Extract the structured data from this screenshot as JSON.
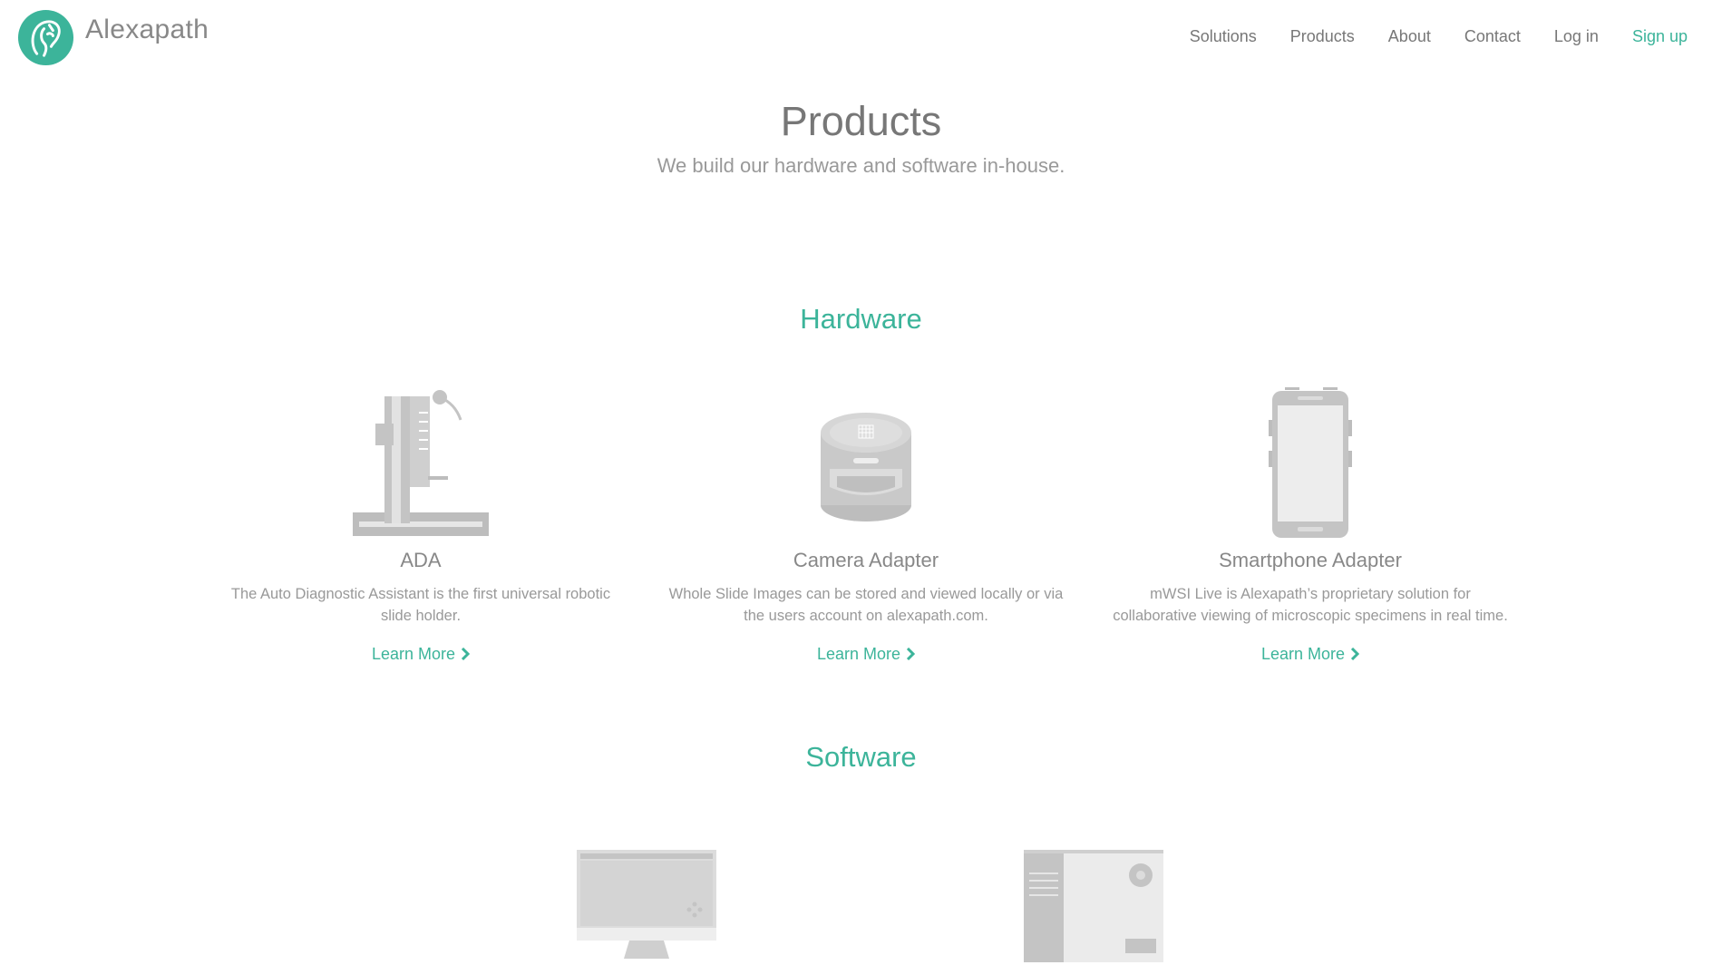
{
  "header": {
    "brand": "Alexapath",
    "nav": {
      "solutions": "Solutions",
      "products": "Products",
      "about": "About",
      "contact": "Contact",
      "login": "Log in",
      "signup": "Sign up"
    }
  },
  "page": {
    "title": "Products",
    "subtitle": "We build our hardware and software in-house."
  },
  "hardware": {
    "title": "Hardware",
    "items": [
      {
        "name": "ADA",
        "description": "The Auto Diagnostic Assistant is the first universal robotic slide holder.",
        "link": "Learn More",
        "icon": "robotic-arm-icon"
      },
      {
        "name": "Camera Adapter",
        "description": "Whole Slide Images can be stored and viewed locally or via the users account on alexapath.com.",
        "link": "Learn More",
        "icon": "camera-adapter-icon"
      },
      {
        "name": "Smartphone Adapter",
        "description": "mWSI Live is Alexapath’s proprietary solution for collaborative viewing of microscopic specimens in real time.",
        "link": "Learn More",
        "icon": "smartphone-icon"
      }
    ]
  },
  "software": {
    "title": "Software",
    "items": [
      {
        "icon": "monitor-icon"
      },
      {
        "icon": "app-window-icon"
      }
    ]
  },
  "colors": {
    "accent": "#3cb49a",
    "text": "#777777",
    "muted": "#999999",
    "icon": "#bbbbbb"
  }
}
